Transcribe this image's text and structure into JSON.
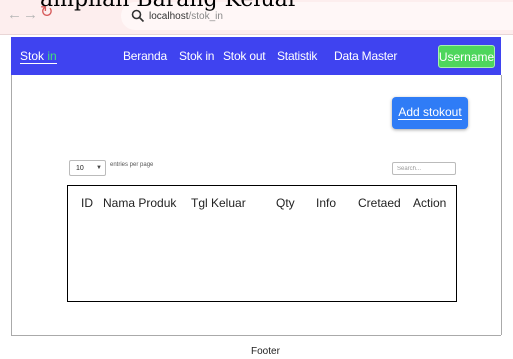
{
  "page_caption": "ampilan Barang Keluar",
  "browser": {
    "address_host": "localhost",
    "address_path": "/stok_in",
    "icons": [
      "back-arrow-icon",
      "forward-arrow-icon",
      "reload-icon",
      "search-icon"
    ]
  },
  "navbar": {
    "brand_prefix": "Stok ",
    "brand_suffix": "in",
    "links": [
      "Beranda",
      "Stok in",
      "Stok out",
      "Statistik",
      "Data Master"
    ],
    "user_button": "Username",
    "bar_color": "#3f43f0",
    "user_button_color": "#4ed65c"
  },
  "main": {
    "add_button": "Add stokout",
    "add_button_color": "#2f7cf6",
    "length_value": "10",
    "length_label": "entries per page",
    "search_placeholder": "Search...",
    "columns": [
      "ID",
      "Nama Produk",
      "Tgl Keluar",
      "Qty",
      "Info",
      "Cretaed",
      "Action"
    ]
  },
  "footer": {
    "text": "Footer"
  }
}
